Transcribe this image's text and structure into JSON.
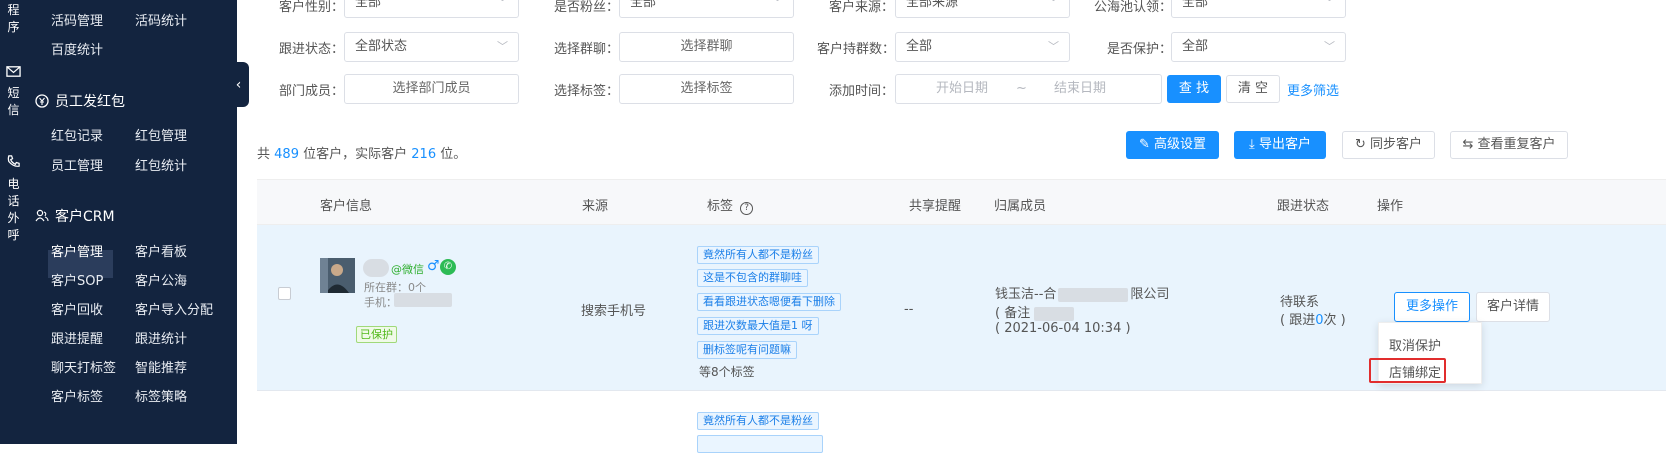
{
  "rail": {
    "items": [
      {
        "icon": "program-icon",
        "chars": [
          "程",
          "序"
        ]
      },
      {
        "icon": "mail-icon",
        "chars": [
          "短",
          "信"
        ]
      },
      {
        "icon": "phone-icon",
        "chars": [
          "电",
          "话",
          "外",
          "呼"
        ]
      }
    ]
  },
  "sidebar": {
    "top_items": [
      "活码管理",
      "活码统计",
      "百度统计"
    ],
    "hongbao_section": "员工发红包",
    "hongbao_items": [
      "红包记录",
      "红包管理",
      "员工管理",
      "红包统计"
    ],
    "crm_section": "客户CRM",
    "crm_items": [
      "客户管理",
      "客户看板",
      "客户SOP",
      "客户公海",
      "客户回收",
      "客户导入分配",
      "跟进提醒",
      "跟进统计",
      "聊天打标签",
      "智能推荐",
      "客户标签",
      "标签策略"
    ],
    "active": "客户管理"
  },
  "filters": {
    "row0": {
      "gender_label": "客户性别：",
      "gender_value": "全部",
      "fans_label": "是否粉丝：",
      "fans_value": "全部",
      "source_label": "客户来源：",
      "source_value": "全部来源",
      "pool_label": "公海池认领：",
      "pool_value": "全部"
    },
    "row1": {
      "follow_label": "跟进状态：",
      "follow_value": "全部状态",
      "group_label": "选择群聊：",
      "group_value": "选择群聊",
      "group_count_label": "客户持群数：",
      "group_count_value": "全部",
      "protect_label": "是否保护：",
      "protect_value": "全部"
    },
    "row2": {
      "dept_label": "部门成员：",
      "dept_value": "选择部门成员",
      "tag_label": "选择标签：",
      "tag_value": "选择标签",
      "time_label": "添加时间：",
      "start_placeholder": "开始日期",
      "sep": "~",
      "end_placeholder": "结束日期",
      "search_btn": "查 找",
      "clear_btn": "清 空",
      "more_filter": "更多筛选"
    }
  },
  "summary": {
    "prefix": "共",
    "total": "489",
    "mid": "位客户，实际客户",
    "actual": "216",
    "suffix": "位。"
  },
  "toolbar": {
    "advanced": "高级设置",
    "export": "导出客户",
    "sync": "同步客户",
    "dup": "查看重复客户"
  },
  "table": {
    "headers": {
      "info": "客户信息",
      "source": "来源",
      "tags": "标签",
      "share": "共享提醒",
      "owner": "归属成员",
      "status": "跟进状态",
      "ops": "操作"
    },
    "row": {
      "wechat": "@微信",
      "groups": "所在群：0个",
      "phone_label": "手机：",
      "protected": "已保护",
      "source": "搜索手机号",
      "tags": [
        "竟然所有人都不是粉丝",
        "这是不包含的群聊哇",
        "看看跟进状态嗯便看下删除",
        "跟进次数最大值是1 呀",
        "删标签呢有问题嘛"
      ],
      "more_tags": "等8个标签",
      "share": "--",
      "owner_name": "钱玉洁--合",
      "owner_company": "限公司",
      "owner_note": "( 备注",
      "owner_time": "( 2021-06-04 10:34 )",
      "status": "待联系",
      "follow_prefix": "( 跟进",
      "follow_count": "0",
      "follow_suffix": "次 )",
      "more_ops": "更多操作",
      "detail": "客户详情",
      "dropdown": [
        "取消保护",
        "店铺绑定"
      ]
    },
    "row2_tags": [
      "竟然所有人都不是粉丝"
    ]
  },
  "colors": {
    "primary": "#1890ff",
    "sidebar": "#13243f",
    "highlight_box": "#e12d2d",
    "row_hover": "#e9f4fd"
  }
}
